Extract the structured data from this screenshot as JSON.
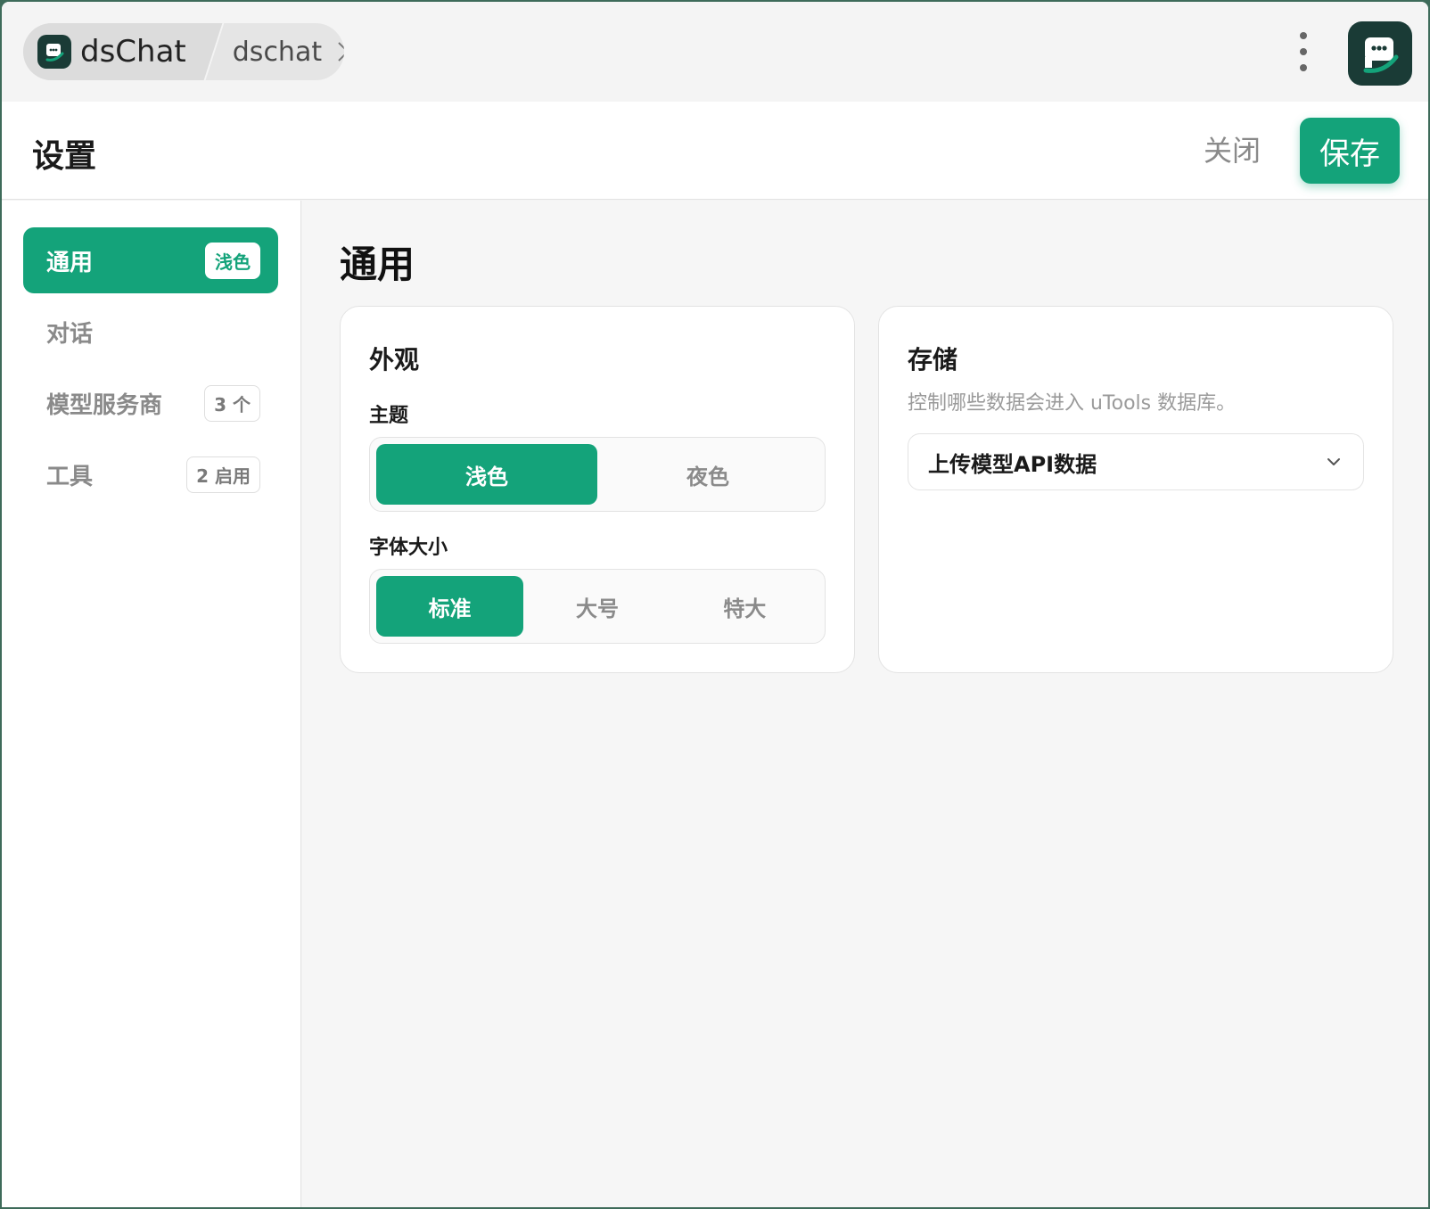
{
  "titlebar": {
    "app_name": "dsChat",
    "tab_name": "dschat"
  },
  "header": {
    "title": "设置",
    "close_label": "关闭",
    "save_label": "保存"
  },
  "sidebar": {
    "items": [
      {
        "label": "通用",
        "badge": "浅色",
        "active": true
      },
      {
        "label": "对话",
        "badge": ""
      },
      {
        "label": "模型服务商",
        "badge": "3 个"
      },
      {
        "label": "工具",
        "badge": "2 启用"
      }
    ]
  },
  "main": {
    "section_title": "通用",
    "appearance": {
      "title": "外观",
      "theme_label": "主题",
      "theme_options": [
        "浅色",
        "夜色"
      ],
      "theme_selected": "浅色",
      "font_size_label": "字体大小",
      "font_size_options": [
        "标准",
        "大号",
        "特大"
      ],
      "font_size_selected": "标准"
    },
    "storage": {
      "title": "存储",
      "description": "控制哪些数据会进入 uTools 数据库。",
      "select_value": "上传模型API数据"
    }
  },
  "colors": {
    "accent": "#14a37a",
    "icon_bg": "#1a3b36"
  },
  "icons": [
    "dschat-logo-icon",
    "close-icon",
    "more-vertical-icon",
    "chevron-down-icon"
  ]
}
